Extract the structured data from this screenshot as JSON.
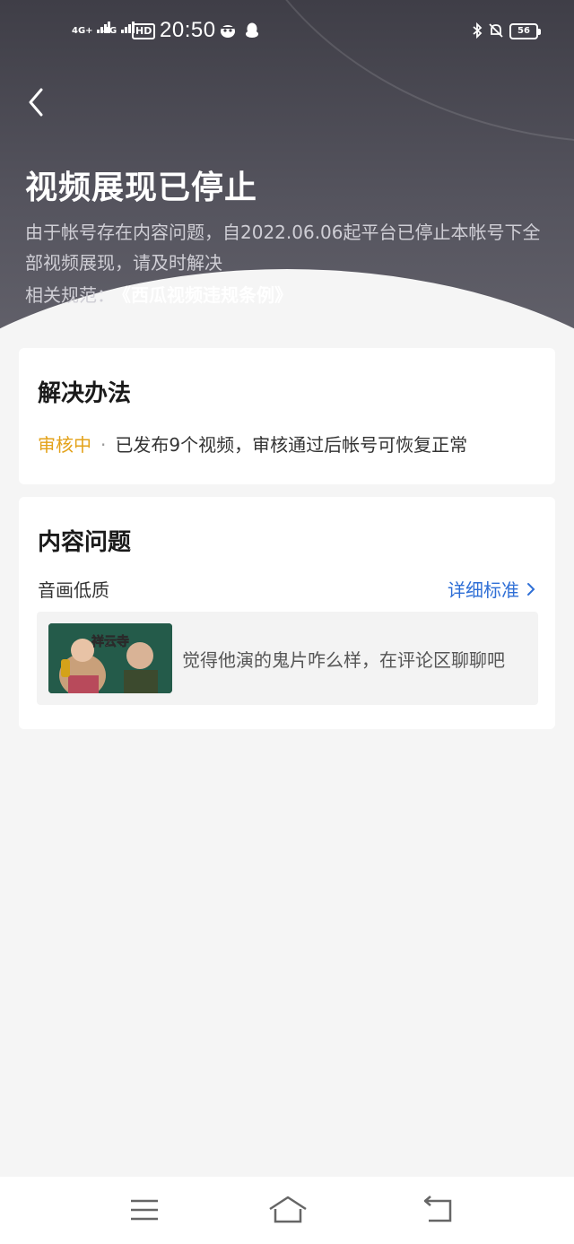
{
  "status_bar": {
    "network_1": "4G+",
    "network_2": "4G",
    "hd_label": "HD",
    "time": "20:50",
    "battery": "56",
    "icons": [
      "signal-icon",
      "hd-voice-icon",
      "app-notification-icon",
      "qq-icon",
      "bluetooth-icon",
      "mute-icon",
      "battery-icon"
    ]
  },
  "header": {
    "title": "视频展现已停止",
    "description": "由于帐号存在内容问题，自2022.06.06起平台已停止本帐号下全部视频展现，请及时解决",
    "rule_prefix": "相关规范：",
    "rule_link": "《西瓜视频违规条例》"
  },
  "solution_card": {
    "title": "解决办法",
    "status": "审核中",
    "separator": "·",
    "message": "已发布9个视频，审核通过后帐号可恢复正常"
  },
  "problem_card": {
    "title": "内容问题",
    "issue_type": "音画低质",
    "detail_link": "详细标准",
    "video": {
      "thumbnail_text": "祥云寺",
      "title": "觉得他演的鬼片咋么样，在评论区聊聊吧"
    }
  },
  "colors": {
    "header_bg": "#4a4952",
    "accent_status": "#e3a21a",
    "link_blue": "#2f6fd6",
    "page_bg": "#f5f5f5"
  },
  "nav_bar": {
    "icons": [
      "menu-icon",
      "home-icon",
      "back-nav-icon"
    ]
  }
}
